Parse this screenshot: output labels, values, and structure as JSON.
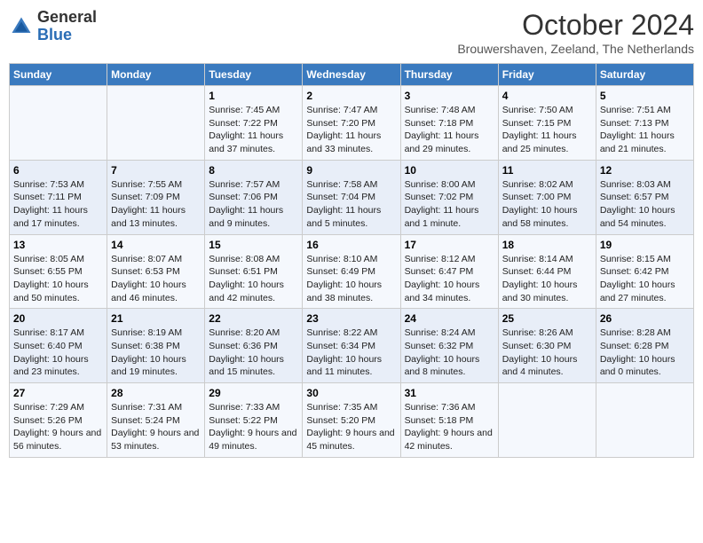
{
  "logo": {
    "general": "General",
    "blue": "Blue"
  },
  "title": "October 2024",
  "location": "Brouwershaven, Zeeland, The Netherlands",
  "days_of_week": [
    "Sunday",
    "Monday",
    "Tuesday",
    "Wednesday",
    "Thursday",
    "Friday",
    "Saturday"
  ],
  "weeks": [
    [
      {
        "day": "",
        "info": ""
      },
      {
        "day": "",
        "info": ""
      },
      {
        "day": "1",
        "sunrise": "7:45 AM",
        "sunset": "7:22 PM",
        "daylight": "11 hours and 37 minutes."
      },
      {
        "day": "2",
        "sunrise": "7:47 AM",
        "sunset": "7:20 PM",
        "daylight": "11 hours and 33 minutes."
      },
      {
        "day": "3",
        "sunrise": "7:48 AM",
        "sunset": "7:18 PM",
        "daylight": "11 hours and 29 minutes."
      },
      {
        "day": "4",
        "sunrise": "7:50 AM",
        "sunset": "7:15 PM",
        "daylight": "11 hours and 25 minutes."
      },
      {
        "day": "5",
        "sunrise": "7:51 AM",
        "sunset": "7:13 PM",
        "daylight": "11 hours and 21 minutes."
      }
    ],
    [
      {
        "day": "6",
        "sunrise": "7:53 AM",
        "sunset": "7:11 PM",
        "daylight": "11 hours and 17 minutes."
      },
      {
        "day": "7",
        "sunrise": "7:55 AM",
        "sunset": "7:09 PM",
        "daylight": "11 hours and 13 minutes."
      },
      {
        "day": "8",
        "sunrise": "7:57 AM",
        "sunset": "7:06 PM",
        "daylight": "11 hours and 9 minutes."
      },
      {
        "day": "9",
        "sunrise": "7:58 AM",
        "sunset": "7:04 PM",
        "daylight": "11 hours and 5 minutes."
      },
      {
        "day": "10",
        "sunrise": "8:00 AM",
        "sunset": "7:02 PM",
        "daylight": "11 hours and 1 minute."
      },
      {
        "day": "11",
        "sunrise": "8:02 AM",
        "sunset": "7:00 PM",
        "daylight": "10 hours and 58 minutes."
      },
      {
        "day": "12",
        "sunrise": "8:03 AM",
        "sunset": "6:57 PM",
        "daylight": "10 hours and 54 minutes."
      }
    ],
    [
      {
        "day": "13",
        "sunrise": "8:05 AM",
        "sunset": "6:55 PM",
        "daylight": "10 hours and 50 minutes."
      },
      {
        "day": "14",
        "sunrise": "8:07 AM",
        "sunset": "6:53 PM",
        "daylight": "10 hours and 46 minutes."
      },
      {
        "day": "15",
        "sunrise": "8:08 AM",
        "sunset": "6:51 PM",
        "daylight": "10 hours and 42 minutes."
      },
      {
        "day": "16",
        "sunrise": "8:10 AM",
        "sunset": "6:49 PM",
        "daylight": "10 hours and 38 minutes."
      },
      {
        "day": "17",
        "sunrise": "8:12 AM",
        "sunset": "6:47 PM",
        "daylight": "10 hours and 34 minutes."
      },
      {
        "day": "18",
        "sunrise": "8:14 AM",
        "sunset": "6:44 PM",
        "daylight": "10 hours and 30 minutes."
      },
      {
        "day": "19",
        "sunrise": "8:15 AM",
        "sunset": "6:42 PM",
        "daylight": "10 hours and 27 minutes."
      }
    ],
    [
      {
        "day": "20",
        "sunrise": "8:17 AM",
        "sunset": "6:40 PM",
        "daylight": "10 hours and 23 minutes."
      },
      {
        "day": "21",
        "sunrise": "8:19 AM",
        "sunset": "6:38 PM",
        "daylight": "10 hours and 19 minutes."
      },
      {
        "day": "22",
        "sunrise": "8:20 AM",
        "sunset": "6:36 PM",
        "daylight": "10 hours and 15 minutes."
      },
      {
        "day": "23",
        "sunrise": "8:22 AM",
        "sunset": "6:34 PM",
        "daylight": "10 hours and 11 minutes."
      },
      {
        "day": "24",
        "sunrise": "8:24 AM",
        "sunset": "6:32 PM",
        "daylight": "10 hours and 8 minutes."
      },
      {
        "day": "25",
        "sunrise": "8:26 AM",
        "sunset": "6:30 PM",
        "daylight": "10 hours and 4 minutes."
      },
      {
        "day": "26",
        "sunrise": "8:28 AM",
        "sunset": "6:28 PM",
        "daylight": "10 hours and 0 minutes."
      }
    ],
    [
      {
        "day": "27",
        "sunrise": "7:29 AM",
        "sunset": "5:26 PM",
        "daylight": "9 hours and 56 minutes."
      },
      {
        "day": "28",
        "sunrise": "7:31 AM",
        "sunset": "5:24 PM",
        "daylight": "9 hours and 53 minutes."
      },
      {
        "day": "29",
        "sunrise": "7:33 AM",
        "sunset": "5:22 PM",
        "daylight": "9 hours and 49 minutes."
      },
      {
        "day": "30",
        "sunrise": "7:35 AM",
        "sunset": "5:20 PM",
        "daylight": "9 hours and 45 minutes."
      },
      {
        "day": "31",
        "sunrise": "7:36 AM",
        "sunset": "5:18 PM",
        "daylight": "9 hours and 42 minutes."
      },
      {
        "day": "",
        "info": ""
      },
      {
        "day": "",
        "info": ""
      }
    ]
  ],
  "labels": {
    "sunrise": "Sunrise:",
    "sunset": "Sunset:",
    "daylight": "Daylight:"
  }
}
